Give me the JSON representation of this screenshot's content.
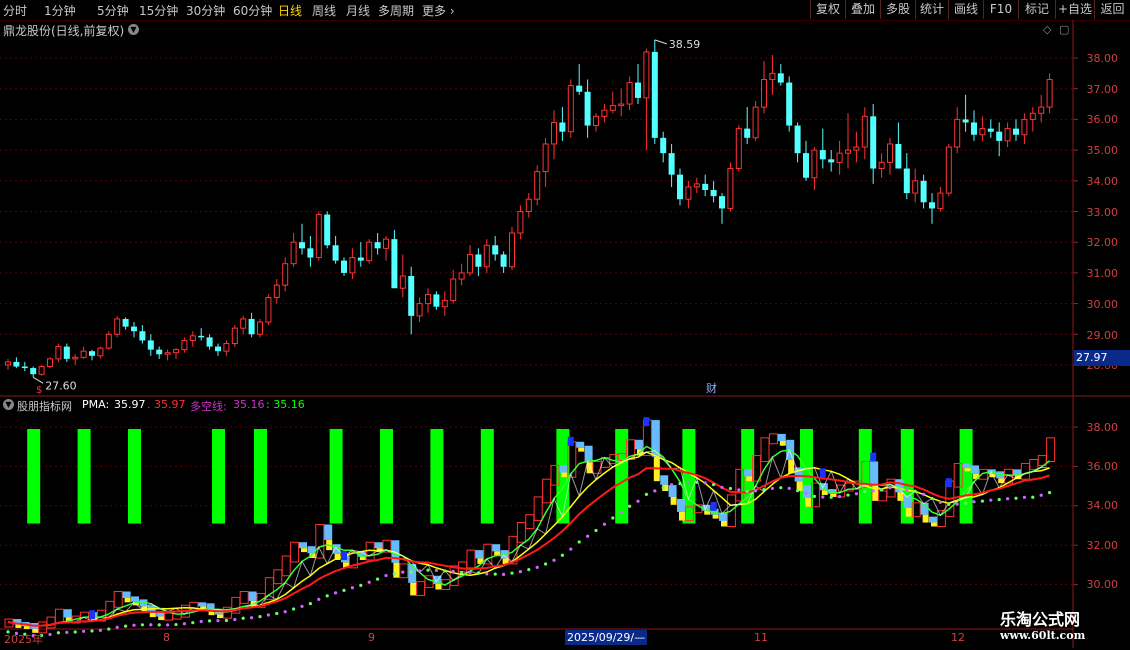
{
  "toolbar": {
    "periods": [
      "分时",
      "1分钟",
      "5分钟",
      "15分钟",
      "30分钟",
      "60分钟",
      "日线",
      "周线",
      "月线",
      "多周期",
      "更多"
    ],
    "active_period": "日线",
    "buttons": [
      "复权",
      "叠加",
      "多股",
      "统计",
      "画线",
      "F10",
      "+自选",
      "返回"
    ],
    "extra_button": "标记"
  },
  "header": {
    "title": "鼎龙股份(日线,前复权)"
  },
  "main_chart": {
    "y_labels": [
      "38.00",
      "37.00",
      "36.00",
      "35.00",
      "34.00",
      "33.00",
      "32.00",
      "31.00",
      "30.00",
      "29.00",
      "28.00"
    ],
    "high_label": "38.59",
    "low_label": "27.60",
    "current_price": "27.97",
    "fin_marker": "财",
    "div_marker": "$"
  },
  "indicator": {
    "name": "股朋指标网",
    "pma_label": "PMA:",
    "pma_value": "35.97",
    "sep_value": ". 35.97",
    "dk_label": "多空线:",
    "dk_value": "35.16",
    "dk_value2": ": 35.16",
    "y_labels": [
      "38.00",
      "36.00",
      "34.00",
      "32.00",
      "30.00"
    ]
  },
  "date_axis": {
    "labels": [
      "2025年",
      "8",
      "9",
      "11",
      "12"
    ],
    "cursor_date": "2025/09/29/—"
  },
  "watermark": {
    "line1": "乐淘公式网",
    "line2": "www.60lt.com"
  },
  "colors": {
    "up": "#ff3232",
    "down": "#54ffff",
    "green_bar": "#00ff00",
    "yellow_line": "#ffff00",
    "magenta": "#cc33cc",
    "axis_red": "#d04040"
  },
  "chart_data": {
    "type": "candlestick",
    "title": "鼎龙股份(日线,前复权)",
    "ylim": [
      27.5,
      38.8
    ],
    "ohlc": [
      [
        28.0,
        28.2,
        27.85,
        28.1
      ],
      [
        28.1,
        28.25,
        27.9,
        27.95
      ],
      [
        27.95,
        28.1,
        27.8,
        27.9
      ],
      [
        27.9,
        27.95,
        27.6,
        27.7
      ],
      [
        27.7,
        28.0,
        27.65,
        27.95
      ],
      [
        27.95,
        28.25,
        27.9,
        28.2
      ],
      [
        28.2,
        28.7,
        28.1,
        28.6
      ],
      [
        28.6,
        28.7,
        28.1,
        28.2
      ],
      [
        28.2,
        28.35,
        28.0,
        28.25
      ],
      [
        28.25,
        28.6,
        28.2,
        28.45
      ],
      [
        28.45,
        28.5,
        28.15,
        28.3
      ],
      [
        28.3,
        28.6,
        28.2,
        28.55
      ],
      [
        28.55,
        29.1,
        28.5,
        29.0
      ],
      [
        29.0,
        29.6,
        28.9,
        29.5
      ],
      [
        29.5,
        29.55,
        29.15,
        29.25
      ],
      [
        29.25,
        29.4,
        28.9,
        29.1
      ],
      [
        29.1,
        29.3,
        28.7,
        28.8
      ],
      [
        28.8,
        29.0,
        28.3,
        28.5
      ],
      [
        28.5,
        28.6,
        28.2,
        28.35
      ],
      [
        28.35,
        28.5,
        28.15,
        28.4
      ],
      [
        28.4,
        28.55,
        28.2,
        28.5
      ],
      [
        28.5,
        28.9,
        28.4,
        28.8
      ],
      [
        28.8,
        29.1,
        28.6,
        28.95
      ],
      [
        28.95,
        29.2,
        28.8,
        28.9
      ],
      [
        28.9,
        29.0,
        28.5,
        28.6
      ],
      [
        28.6,
        28.7,
        28.3,
        28.45
      ],
      [
        28.45,
        28.8,
        28.3,
        28.7
      ],
      [
        28.7,
        29.3,
        28.6,
        29.2
      ],
      [
        29.2,
        29.6,
        29.0,
        29.5
      ],
      [
        29.5,
        29.7,
        28.9,
        29.0
      ],
      [
        29.0,
        29.5,
        28.9,
        29.4
      ],
      [
        29.4,
        30.3,
        29.3,
        30.2
      ],
      [
        30.2,
        30.8,
        30.0,
        30.6
      ],
      [
        30.6,
        31.5,
        30.4,
        31.3
      ],
      [
        31.3,
        32.3,
        31.2,
        32.0
      ],
      [
        32.0,
        32.6,
        31.6,
        31.8
      ],
      [
        31.8,
        32.2,
        31.2,
        31.5
      ],
      [
        31.5,
        33.0,
        31.4,
        32.9
      ],
      [
        32.9,
        33.0,
        31.8,
        31.9
      ],
      [
        31.9,
        32.2,
        31.3,
        31.4
      ],
      [
        31.4,
        31.5,
        30.9,
        31.0
      ],
      [
        31.0,
        31.8,
        30.8,
        31.5
      ],
      [
        31.5,
        32.0,
        31.2,
        31.4
      ],
      [
        31.4,
        32.1,
        31.3,
        32.0
      ],
      [
        32.0,
        32.3,
        31.6,
        31.8
      ],
      [
        31.8,
        32.2,
        31.4,
        32.1
      ],
      [
        32.1,
        32.4,
        30.6,
        30.5
      ],
      [
        30.5,
        31.6,
        30.2,
        30.9
      ],
      [
        30.9,
        31.2,
        29.0,
        29.6
      ],
      [
        29.6,
        30.2,
        29.4,
        30.0
      ],
      [
        30.0,
        30.5,
        29.7,
        30.3
      ],
      [
        30.3,
        30.4,
        29.8,
        29.9
      ],
      [
        29.9,
        30.4,
        29.6,
        30.1
      ],
      [
        30.1,
        31.1,
        30.0,
        30.8
      ],
      [
        30.8,
        31.3,
        30.6,
        31.0
      ],
      [
        31.0,
        31.9,
        30.9,
        31.6
      ],
      [
        31.6,
        31.8,
        30.9,
        31.2
      ],
      [
        31.2,
        32.1,
        31.0,
        31.9
      ],
      [
        31.9,
        32.2,
        31.4,
        31.6
      ],
      [
        31.6,
        31.7,
        31.0,
        31.2
      ],
      [
        31.2,
        32.5,
        31.1,
        32.3
      ],
      [
        32.3,
        33.2,
        32.1,
        33.0
      ],
      [
        33.0,
        33.6,
        32.8,
        33.4
      ],
      [
        33.4,
        34.5,
        33.2,
        34.3
      ],
      [
        34.3,
        35.4,
        33.8,
        35.2
      ],
      [
        35.2,
        36.3,
        34.7,
        35.9
      ],
      [
        35.9,
        36.4,
        35.3,
        35.6
      ],
      [
        35.6,
        37.3,
        35.4,
        37.1
      ],
      [
        37.1,
        37.8,
        36.8,
        36.9
      ],
      [
        36.9,
        37.3,
        35.4,
        35.8
      ],
      [
        35.8,
        36.2,
        35.6,
        36.1
      ],
      [
        36.1,
        36.5,
        35.9,
        36.3
      ],
      [
        36.3,
        36.9,
        36.2,
        36.45
      ],
      [
        36.45,
        37.0,
        36.1,
        36.5
      ],
      [
        36.5,
        37.4,
        36.3,
        37.2
      ],
      [
        37.2,
        37.8,
        36.5,
        36.7
      ],
      [
        36.7,
        38.3,
        35.0,
        38.2
      ],
      [
        38.2,
        38.59,
        35.2,
        35.4
      ],
      [
        35.4,
        35.6,
        34.6,
        34.9
      ],
      [
        34.9,
        35.2,
        33.8,
        34.2
      ],
      [
        34.2,
        34.4,
        33.2,
        33.4
      ],
      [
        33.4,
        34.0,
        33.1,
        33.8
      ],
      [
        33.8,
        34.1,
        33.6,
        33.9
      ],
      [
        33.9,
        34.2,
        33.5,
        33.7
      ],
      [
        33.7,
        34.0,
        33.3,
        33.5
      ],
      [
        33.5,
        33.6,
        32.6,
        33.1
      ],
      [
        33.1,
        34.6,
        33.0,
        34.4
      ],
      [
        34.4,
        35.8,
        34.3,
        35.7
      ],
      [
        35.7,
        36.4,
        35.2,
        35.4
      ],
      [
        35.4,
        36.6,
        35.3,
        36.4
      ],
      [
        36.4,
        37.9,
        36.2,
        37.3
      ],
      [
        37.3,
        38.1,
        36.8,
        37.5
      ],
      [
        37.5,
        37.8,
        37.1,
        37.2
      ],
      [
        37.2,
        37.4,
        35.6,
        35.8
      ],
      [
        35.8,
        35.9,
        34.6,
        34.9
      ],
      [
        34.9,
        35.3,
        34.0,
        34.1
      ],
      [
        34.1,
        35.1,
        33.7,
        35.0
      ],
      [
        35.0,
        35.7,
        34.4,
        34.7
      ],
      [
        34.7,
        35.0,
        34.3,
        34.6
      ],
      [
        34.6,
        35.3,
        34.2,
        34.9
      ],
      [
        34.9,
        36.2,
        34.4,
        35.0
      ],
      [
        35.0,
        35.6,
        34.6,
        35.1
      ],
      [
        35.1,
        36.4,
        34.7,
        36.1
      ],
      [
        36.1,
        36.5,
        33.9,
        34.4
      ],
      [
        34.4,
        34.9,
        34.1,
        34.6
      ],
      [
        34.6,
        35.4,
        34.2,
        35.2
      ],
      [
        35.2,
        35.9,
        34.4,
        34.4
      ],
      [
        34.4,
        34.9,
        33.4,
        33.6
      ],
      [
        33.6,
        34.4,
        33.3,
        34.0
      ],
      [
        34.0,
        34.2,
        33.1,
        33.3
      ],
      [
        33.3,
        33.6,
        32.6,
        33.1
      ],
      [
        33.1,
        33.8,
        33.0,
        33.6
      ],
      [
        33.6,
        35.2,
        33.5,
        35.1
      ],
      [
        35.1,
        36.4,
        34.9,
        36.0
      ],
      [
        36.0,
        36.8,
        35.6,
        35.9
      ],
      [
        35.9,
        36.3,
        35.3,
        35.5
      ],
      [
        35.5,
        36.1,
        35.3,
        35.7
      ],
      [
        35.7,
        36.0,
        35.4,
        35.6
      ],
      [
        35.6,
        35.9,
        34.8,
        35.3
      ],
      [
        35.3,
        35.9,
        35.1,
        35.7
      ],
      [
        35.7,
        36.0,
        35.3,
        35.5
      ],
      [
        35.5,
        36.2,
        35.2,
        36.0
      ],
      [
        36.0,
        36.4,
        35.6,
        36.2
      ],
      [
        36.2,
        36.8,
        35.9,
        36.4
      ],
      [
        36.4,
        37.5,
        36.2,
        37.3
      ]
    ]
  }
}
